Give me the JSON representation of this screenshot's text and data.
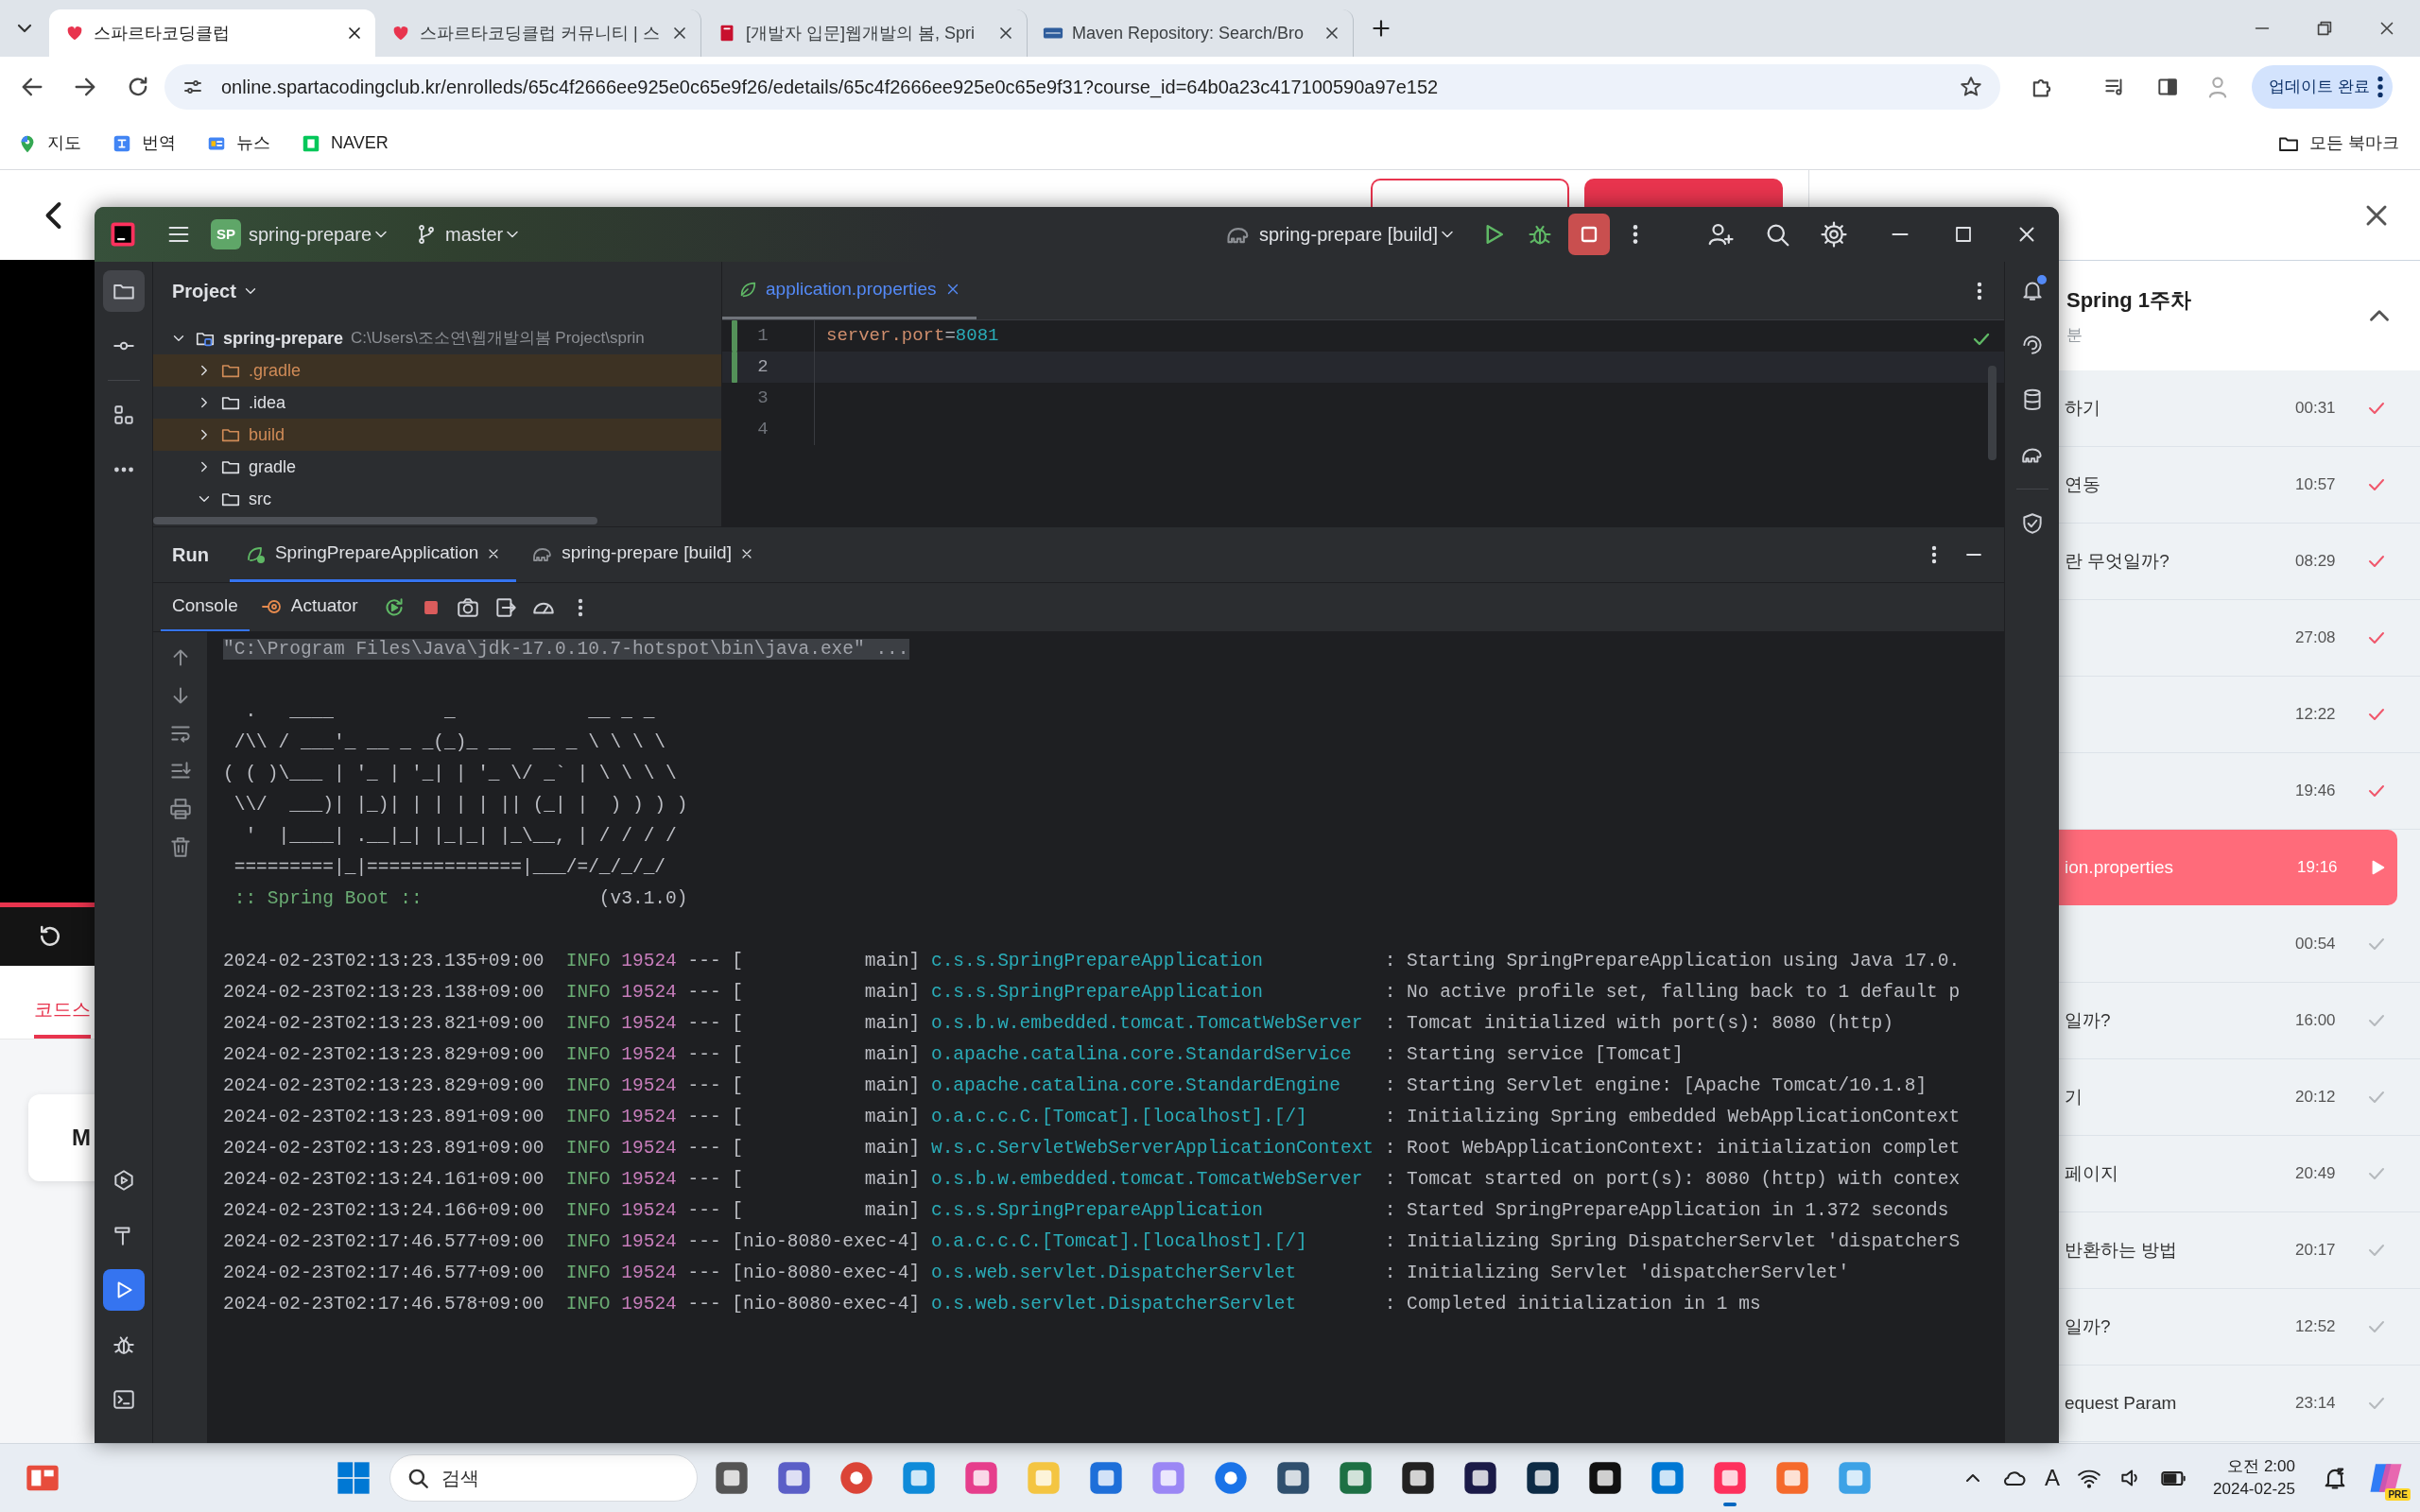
{
  "browser": {
    "tabs": [
      {
        "title": "스파르타코딩클럽",
        "selected": true
      },
      {
        "title": "스파르타코딩클럽 커뮤니티 | 스",
        "selected": false
      },
      {
        "title": "[개발자 입문]웹개발의 봄, Spri",
        "selected": false
      },
      {
        "title": "Maven Repository: Search/Bro",
        "selected": false
      }
    ],
    "address": "online.spartacodingclub.kr/enrolleds/65c4f2666ee925e0c65e9f26/edetails/65c4f2666ee925e0c65e9f31?course_id=64b0a23c417100590a97e152",
    "update_button": "업데이트 완료",
    "bookmarks": [
      {
        "label": "지도"
      },
      {
        "label": "번역"
      },
      {
        "label": "뉴스"
      },
      {
        "label": "NAVER"
      }
    ],
    "all_bookmarks": "모든 북마크"
  },
  "page": {
    "tab_label": "코드스",
    "card_label": "M",
    "sidebar": {
      "section_title": "Spring 1주차",
      "section_subtitle": "분",
      "expanded": true,
      "lessons": [
        {
          "title": "하기",
          "time": "00:31",
          "done": true,
          "selected": false
        },
        {
          "title": "연동",
          "time": "10:57",
          "done": true,
          "selected": false
        },
        {
          "title": "란 무엇일까?",
          "time": "08:29",
          "done": true,
          "selected": false
        },
        {
          "time": "27:08",
          "done": true,
          "selected": false
        },
        {
          "time": "12:22",
          "done": true,
          "selected": false
        },
        {
          "time": "19:46",
          "done": true,
          "selected": false
        },
        {
          "title": "ion.properties",
          "time": "19:16",
          "selected": true
        },
        {
          "time": "00:54",
          "done": false,
          "selected": false
        },
        {
          "title": "일까?",
          "time": "16:00",
          "done": false,
          "selected": false
        },
        {
          "title": "기",
          "time": "20:12",
          "done": false,
          "selected": false
        },
        {
          "title": "페이지",
          "time": "20:49",
          "done": false,
          "selected": false
        },
        {
          "title": "반환하는 방법",
          "time": "20:17",
          "done": false,
          "selected": false
        },
        {
          "title": "일까?",
          "time": "12:52",
          "done": false,
          "selected": false
        },
        {
          "title": "equest Param",
          "time": "23:14",
          "done": false,
          "selected": false
        }
      ]
    }
  },
  "ide": {
    "project_badge": "SP",
    "project": "spring-prepare",
    "branch": "master",
    "run_config": "spring-prepare [build]",
    "running": true,
    "notifications_unread": true,
    "project_panel": {
      "title": "Project",
      "tree": [
        {
          "name": "spring-prepare",
          "path": "C:\\Users\\조소연\\웹개발의봄 Project\\sprin",
          "expanded": true,
          "excluded": false,
          "children": [
            {
              "name": ".gradle",
              "expanded": false,
              "excluded": true
            },
            {
              "name": ".idea",
              "expanded": false,
              "excluded": false
            },
            {
              "name": "build",
              "expanded": false,
              "excluded": true
            },
            {
              "name": "gradle",
              "expanded": false,
              "excluded": false
            },
            {
              "name": "src",
              "expanded": true,
              "excluded": false
            }
          ]
        }
      ]
    },
    "editor": {
      "tabs": [
        {
          "label": "application.properties",
          "selected": true
        }
      ],
      "lines": [
        {
          "number": "1",
          "key": "server.port",
          "sign": "=",
          "value": "8081",
          "current": false,
          "changed": true
        },
        {
          "number": "2",
          "current": true,
          "changed": true
        },
        {
          "number": "3",
          "current": false,
          "changed": false
        },
        {
          "number": "4",
          "current": false,
          "changed": false
        }
      ]
    },
    "run": {
      "title": "Run",
      "tabs": [
        {
          "label": "SpringPrepareApplication",
          "kind": "app",
          "selected": true
        },
        {
          "label": "spring-prepare [build]",
          "kind": "gradle",
          "selected": false
        }
      ],
      "subtabs": [
        {
          "label": "Console",
          "kind": "console",
          "selected": true
        },
        {
          "label": "Actuator",
          "kind": "actuator",
          "selected": false
        }
      ],
      "command": "\"C:\\Program Files\\Java\\jdk-17.0.10.7-hotspot\\bin\\java.exe\" ...",
      "banner": [
        "  .   ____          _            __ _ _",
        " /\\\\ / ___'_ __ _ _(_)_ __  __ _ \\ \\ \\ \\",
        "( ( )\\___ | '_ | '_| | '_ \\/ _` | \\ \\ \\ \\",
        " \\\\/  ___)| |_)| | | | | || (_| |  ) ) ) )",
        "  '  |____| .__|_| |_|_| |_\\__, | / / / /",
        " =========|_|==============|___/=/_/_/_/"
      ],
      "boot_label": ":: Spring Boot ::",
      "boot_version": "(v3.1.0)",
      "logs": [
        {
          "time": "2024-02-23T02:13:23.135+09:00",
          "level": "INFO",
          "pid": "19524",
          "sep": "---",
          "thread": "[           main]",
          "logger": "c.s.s.SpringPrepareApplication",
          "message": ": Starting SpringPrepareApplication using Java 17.0."
        },
        {
          "time": "2024-02-23T02:13:23.138+09:00",
          "level": "INFO",
          "pid": "19524",
          "sep": "---",
          "thread": "[           main]",
          "logger": "c.s.s.SpringPrepareApplication",
          "message": ": No active profile set, falling back to 1 default p"
        },
        {
          "time": "2024-02-23T02:13:23.821+09:00",
          "level": "INFO",
          "pid": "19524",
          "sep": "---",
          "thread": "[           main]",
          "logger": "o.s.b.w.embedded.tomcat.TomcatWebServer",
          "message": ": Tomcat initialized with port(s): 8080 (http)"
        },
        {
          "time": "2024-02-23T02:13:23.829+09:00",
          "level": "INFO",
          "pid": "19524",
          "sep": "---",
          "thread": "[           main]",
          "logger": "o.apache.catalina.core.StandardService",
          "message": ": Starting service [Tomcat]"
        },
        {
          "time": "2024-02-23T02:13:23.829+09:00",
          "level": "INFO",
          "pid": "19524",
          "sep": "---",
          "thread": "[           main]",
          "logger": "o.apache.catalina.core.StandardEngine",
          "message": ": Starting Servlet engine: [Apache Tomcat/10.1.8]"
        },
        {
          "time": "2024-02-23T02:13:23.891+09:00",
          "level": "INFO",
          "pid": "19524",
          "sep": "---",
          "thread": "[           main]",
          "logger": "o.a.c.c.C.[Tomcat].[localhost].[/]",
          "message": ": Initializing Spring embedded WebApplicationContext"
        },
        {
          "time": "2024-02-23T02:13:23.891+09:00",
          "level": "INFO",
          "pid": "19524",
          "sep": "---",
          "thread": "[           main]",
          "logger": "w.s.c.ServletWebServerApplicationContext",
          "message": ": Root WebApplicationContext: initialization complet"
        },
        {
          "time": "2024-02-23T02:13:24.161+09:00",
          "level": "INFO",
          "pid": "19524",
          "sep": "---",
          "thread": "[           main]",
          "logger": "o.s.b.w.embedded.tomcat.TomcatWebServer",
          "message": ": Tomcat started on port(s): 8080 (http) with contex"
        },
        {
          "time": "2024-02-23T02:13:24.166+09:00",
          "level": "INFO",
          "pid": "19524",
          "sep": "---",
          "thread": "[           main]",
          "logger": "c.s.s.SpringPrepareApplication",
          "message": ": Started SpringPrepareApplication in 1.372 seconds"
        },
        {
          "time": "2024-02-23T02:17:46.577+09:00",
          "level": "INFO",
          "pid": "19524",
          "sep": "---",
          "thread": "[nio-8080-exec-4]",
          "logger": "o.a.c.c.C.[Tomcat].[localhost].[/]",
          "message": ": Initializing Spring DispatcherServlet 'dispatcherS"
        },
        {
          "time": "2024-02-23T02:17:46.577+09:00",
          "level": "INFO",
          "pid": "19524",
          "sep": "---",
          "thread": "[nio-8080-exec-4]",
          "logger": "o.s.web.servlet.DispatcherServlet",
          "message": ": Initializing Servlet 'dispatcherServlet'"
        },
        {
          "time": "2024-02-23T02:17:46.578+09:00",
          "level": "INFO",
          "pid": "19524",
          "sep": "---",
          "thread": "[nio-8080-exec-4]",
          "logger": "o.s.web.servlet.DispatcherServlet",
          "message": ": Completed initialization in 1 ms"
        }
      ]
    }
  },
  "taskbar": {
    "search_placeholder": "검색",
    "input_indicator": "A",
    "time": "오전 2:00",
    "date": "2024-02-25",
    "copilot_badge": "PRE"
  }
}
